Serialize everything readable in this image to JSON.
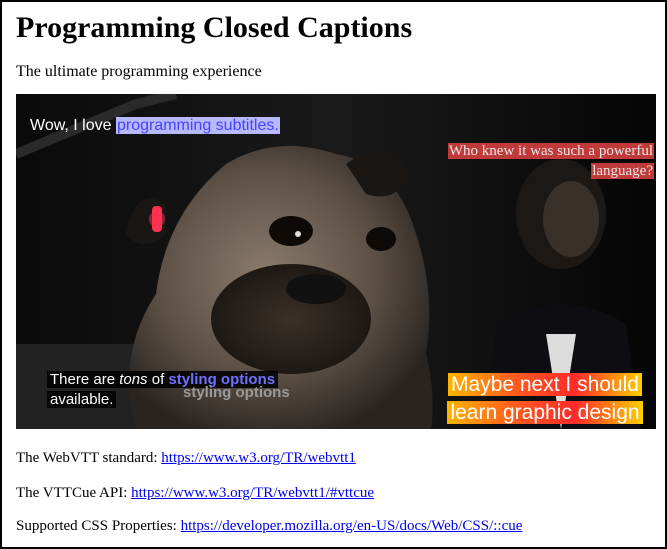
{
  "page": {
    "title": "Programming Closed Captions",
    "subtitle": "The ultimate programming experience"
  },
  "video": {
    "cues": {
      "cue1": {
        "text_before": "Wow, I love ",
        "highlight": "programming subtitles."
      },
      "cue2": {
        "line1": "Who knew it was such a powerful",
        "line2": "language?"
      },
      "cue3": {
        "text_before": "There are ",
        "italic": "tons",
        "text_mid": " of ",
        "styled": "styling options",
        "line2": "available.",
        "shadow": "styling options"
      },
      "cue4": {
        "line1": "Maybe next I should",
        "line2": "learn graphic design"
      }
    }
  },
  "links": [
    {
      "label": "The WebVTT standard: ",
      "url": "https://www.w3.org/TR/webvtt1"
    },
    {
      "label": "The VTTCue API: ",
      "url": "https://www.w3.org/TR/webvtt1/#vttcue"
    },
    {
      "label": "Supported CSS Properties: ",
      "url": "https://developer.mozilla.org/en-US/docs/Web/CSS/::cue"
    }
  ]
}
